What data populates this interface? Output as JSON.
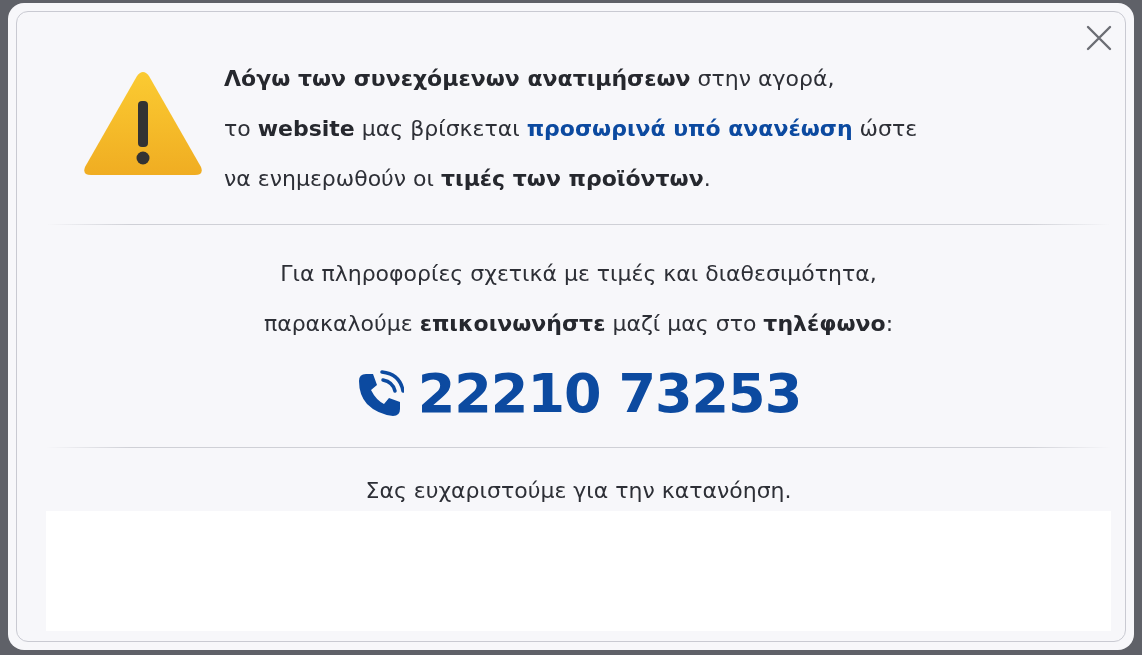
{
  "dialog": {
    "notice": {
      "lines": [
        [
          {
            "kind": "bold",
            "text": "Λόγω των συνεχόμενων ανατιμήσεων"
          },
          {
            "kind": "plain",
            "text": " στην αγορά,"
          }
        ],
        [
          {
            "kind": "plain",
            "text": "το "
          },
          {
            "kind": "bold",
            "text": "website"
          },
          {
            "kind": "plain",
            "text": " μας βρίσκεται "
          },
          {
            "kind": "accent",
            "text": "προσωρινά υπό ανανέωση"
          },
          {
            "kind": "plain",
            "text": " ώστε"
          }
        ],
        [
          {
            "kind": "plain",
            "text": "να ενημερωθούν οι "
          },
          {
            "kind": "bold",
            "text": "τιμές των προϊόντων"
          },
          {
            "kind": "plain",
            "text": "."
          }
        ]
      ]
    },
    "contact": {
      "lines": [
        [
          {
            "kind": "plain",
            "text": "Για πληροφορίες σχετικά με τιμές και διαθεσιμότητα,"
          }
        ],
        [
          {
            "kind": "plain",
            "text": "παρακαλούμε "
          },
          {
            "kind": "bold",
            "text": "επικοινωνήστε"
          },
          {
            "kind": "plain",
            "text": " μαζί μας στο "
          },
          {
            "kind": "bold",
            "text": "τηλέφωνο"
          },
          {
            "kind": "plain",
            "text": ":"
          }
        ]
      ]
    },
    "phone": "22210 73253",
    "thanks": "Σας ευχαριστούμε για την κατανόηση."
  }
}
